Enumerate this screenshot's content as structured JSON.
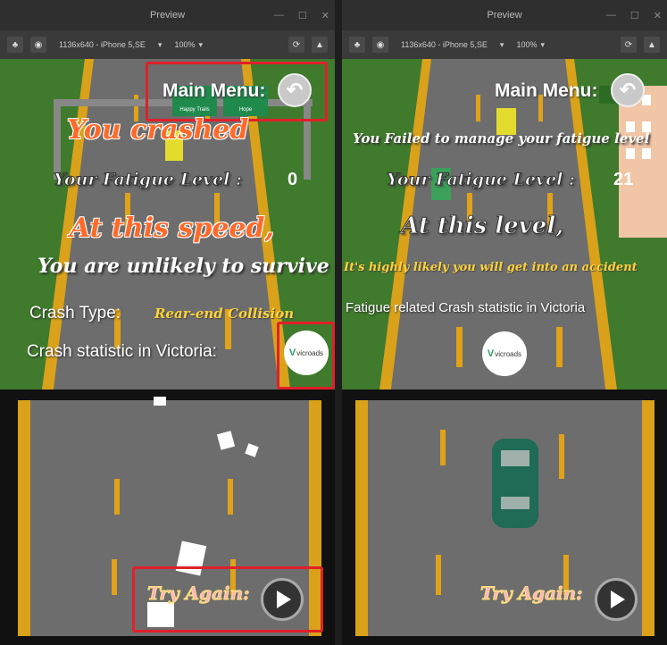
{
  "window_title": "Preview",
  "toolbar": {
    "resolution": "1136x640 - iPhone 5,SE",
    "zoom": "100%",
    "dropdown_arrow": "▾"
  },
  "icons": {
    "scene": "tree-icon",
    "camera": "camera-icon",
    "refresh": "refresh-icon",
    "warning": "warning-icon",
    "back": "back-arrow-icon",
    "play": "play-icon"
  },
  "left": {
    "main_menu": "Main Menu:",
    "headline": "You crashed",
    "fatigue_label": "Your Fatigue Level :",
    "fatigue_value": "0",
    "speed": "At this speed,",
    "survive": "You are unlikely to survive",
    "crash_type_label": "Crash Type:",
    "crash_type_value": "Rear-end Collision",
    "stat_label": "Crash statistic in Victoria:",
    "vicroads": "vicroads",
    "try_again": "Try Again:",
    "sign_texts": [
      "Happy Trails",
      "Hope"
    ]
  },
  "right": {
    "main_menu": "Main Menu:",
    "headline": "You Failed to manage your fatigue level",
    "fatigue_label": "Your Fatigue Level :",
    "fatigue_value": "21",
    "level": "At this level,",
    "accident": "It's highly likely you will get into an accident",
    "stat_label": "Fatigue related Crash statistic in Victoria",
    "vicroads": "vicroads",
    "try_again": "Try Again:"
  },
  "colors": {
    "highlight": "#e0202a",
    "road": "#6d6d6d",
    "grass": "#3f7a2d",
    "lane": "#e0a21a"
  }
}
